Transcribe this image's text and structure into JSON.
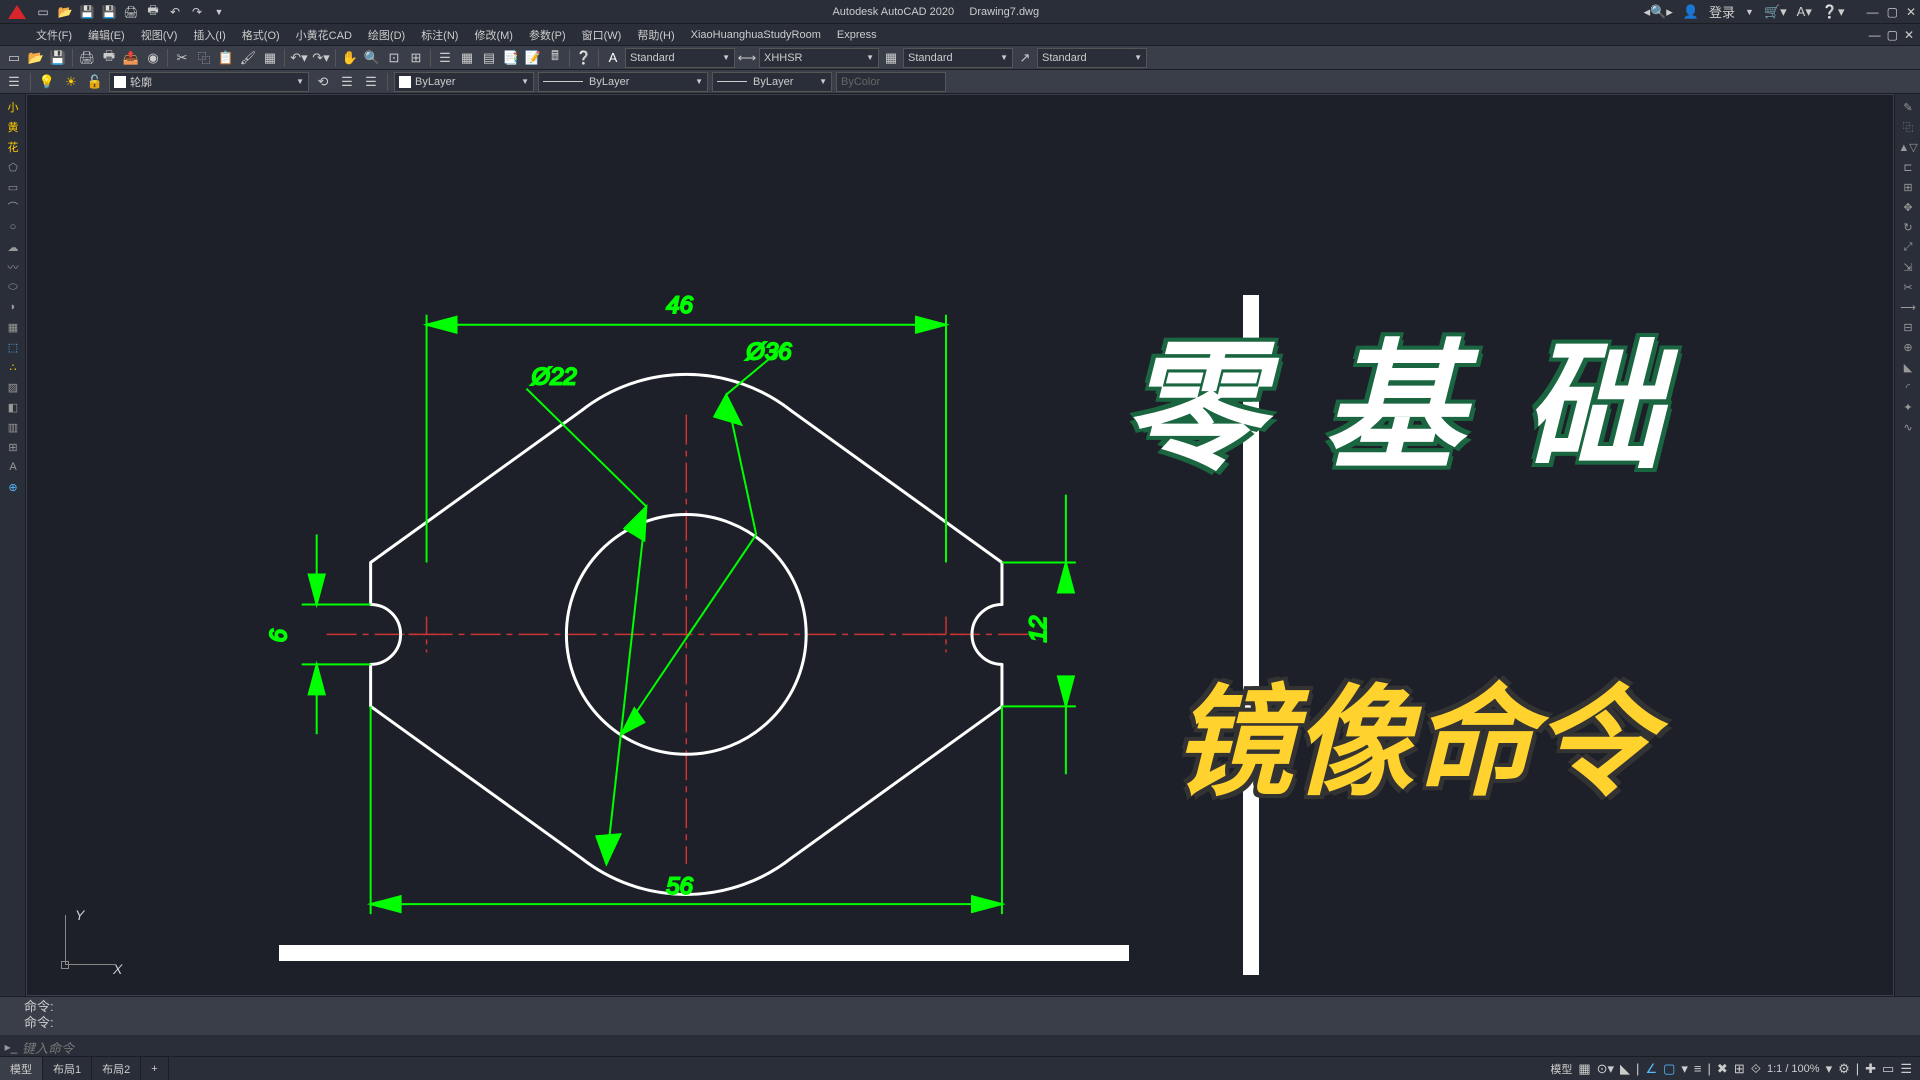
{
  "title": {
    "app": "Autodesk AutoCAD 2020",
    "file": "Drawing7.dwg"
  },
  "title_right": {
    "login": "登录",
    "search_icon": "⌕",
    "help_icon": "?"
  },
  "menus": [
    "文件(F)",
    "编辑(E)",
    "视图(V)",
    "插入(I)",
    "格式(O)",
    "小黄花CAD",
    "绘图(D)",
    "标注(N)",
    "修改(M)",
    "参数(P)",
    "窗口(W)",
    "帮助(H)",
    "XiaoHuanghuaStudyRoom",
    "Express"
  ],
  "toolbar1": {
    "text_style": "Standard",
    "dim_style": "XHHSR",
    "table_style": "Standard",
    "mleader_style": "Standard"
  },
  "toolbar2": {
    "layer": "轮廓",
    "color": "ByLayer",
    "linetype": "ByLayer",
    "lineweight": "ByLayer",
    "plotstyle": "ByColor"
  },
  "left_tools_label": [
    "小",
    "黄",
    "花"
  ],
  "drawing": {
    "dims": {
      "d46": "46",
      "d56": "56",
      "d36": "Ø36",
      "d22": "Ø22",
      "h6": "6",
      "h12": "12"
    },
    "ucs": {
      "x": "X",
      "y": "Y"
    }
  },
  "overlay": {
    "title1": "零基础",
    "title2": "镜像命令"
  },
  "command": {
    "hist1": "命令:",
    "hist2": "命令:",
    "prompt": "键入命令",
    "icon": "▸_"
  },
  "tabs": {
    "model": "模型",
    "layout1": "布局1",
    "layout2": "布局2",
    "add": "+"
  },
  "status": {
    "model": "模型",
    "scale": "1:1 / 100%"
  },
  "chart_data": {
    "type": "diagram",
    "description": "Mechanical flange part drawing with mirror symmetry",
    "outer_width": 56,
    "top_width": 46,
    "inner_circle_dia": 36,
    "arc_dia": 22,
    "slot_height_left": 6,
    "slot_height_right": 12
  }
}
